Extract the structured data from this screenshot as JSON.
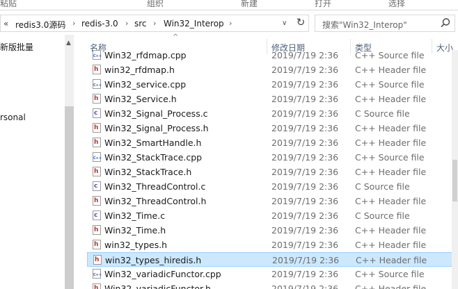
{
  "ribbon": {
    "items": [
      "粘贴",
      "组织",
      "新建",
      "打开",
      "选择"
    ]
  },
  "address_bar": {
    "overflow": "«",
    "crumbs": [
      "redis3.0源码",
      "redis-3.0",
      "src",
      "Win32_Interop"
    ],
    "separator": "›",
    "dropdown": "∨",
    "refresh_glyph": "↻"
  },
  "search": {
    "placeholder": "搜索\"Win32_Interop\""
  },
  "nav_pane": {
    "items": [
      "新版批量",
      "rsonal"
    ],
    "scroll_up": "▲"
  },
  "columns": {
    "name": "名称",
    "date": "修改日期",
    "type": "类型",
    "size": "大小",
    "sort_indicator": "^"
  },
  "files": [
    {
      "name": "Win32_rfdmap.cpp",
      "date": "2019/7/19 2:36",
      "type": "C++ Source file",
      "icon": "cpp-file-icon",
      "glyph": "C++",
      "color": "#1f5fbf",
      "partial": true
    },
    {
      "name": "win32_rfdmap.h",
      "date": "2019/7/19 2:36",
      "type": "C++ Header file",
      "icon": "header-file-icon",
      "glyph": "h",
      "color": "#b5332f"
    },
    {
      "name": "Win32_service.cpp",
      "date": "2019/7/19 2:36",
      "type": "C++ Source file",
      "icon": "cpp-file-icon",
      "glyph": "C++",
      "color": "#1f5fbf"
    },
    {
      "name": "Win32_Service.h",
      "date": "2019/7/19 2:36",
      "type": "C++ Header file",
      "icon": "header-file-icon",
      "glyph": "h",
      "color": "#b5332f"
    },
    {
      "name": "Win32_Signal_Process.c",
      "date": "2019/7/19 2:36",
      "type": "C Source file",
      "icon": "c-file-icon",
      "glyph": "c",
      "color": "#5a4cb5"
    },
    {
      "name": "Win32_Signal_Process.h",
      "date": "2019/7/19 2:36",
      "type": "C++ Header file",
      "icon": "header-file-icon",
      "glyph": "h",
      "color": "#b5332f"
    },
    {
      "name": "Win32_SmartHandle.h",
      "date": "2019/7/19 2:36",
      "type": "C++ Header file",
      "icon": "header-file-icon",
      "glyph": "h",
      "color": "#b5332f"
    },
    {
      "name": "Win32_StackTrace.cpp",
      "date": "2019/7/19 2:36",
      "type": "C++ Source file",
      "icon": "cpp-file-icon",
      "glyph": "C++",
      "color": "#1f5fbf"
    },
    {
      "name": "Win32_StackTrace.h",
      "date": "2019/7/19 2:36",
      "type": "C++ Header file",
      "icon": "header-file-icon",
      "glyph": "h",
      "color": "#b5332f"
    },
    {
      "name": "Win32_ThreadControl.c",
      "date": "2019/7/19 2:36",
      "type": "C Source file",
      "icon": "c-file-icon",
      "glyph": "c",
      "color": "#5a4cb5"
    },
    {
      "name": "Win32_ThreadControl.h",
      "date": "2019/7/19 2:36",
      "type": "C++ Header file",
      "icon": "header-file-icon",
      "glyph": "h",
      "color": "#b5332f"
    },
    {
      "name": "Win32_Time.c",
      "date": "2019/7/19 2:36",
      "type": "C Source file",
      "icon": "c-file-icon",
      "glyph": "c",
      "color": "#5a4cb5"
    },
    {
      "name": "Win32_Time.h",
      "date": "2019/7/19 2:36",
      "type": "C++ Header file",
      "icon": "header-file-icon",
      "glyph": "h",
      "color": "#b5332f"
    },
    {
      "name": "win32_types.h",
      "date": "2019/7/19 2:36",
      "type": "C++ Header file",
      "icon": "header-file-icon",
      "glyph": "h",
      "color": "#b5332f"
    },
    {
      "name": "win32_types_hiredis.h",
      "date": "2019/7/19 2:36",
      "type": "C++ Header file",
      "icon": "header-file-icon",
      "glyph": "h",
      "color": "#b5332f",
      "selected": true
    },
    {
      "name": "Win32_variadicFunctor.cpp",
      "date": "2019/7/19 2:36",
      "type": "C++ Source file",
      "icon": "cpp-file-icon",
      "glyph": "C++",
      "color": "#1f5fbf"
    },
    {
      "name": "Win32_variadicFunctor.h",
      "date": "2019/7/19 2:36",
      "type": "C++ Header file",
      "icon": "header-file-icon",
      "glyph": "h",
      "color": "#b5332f",
      "partial": true
    }
  ]
}
